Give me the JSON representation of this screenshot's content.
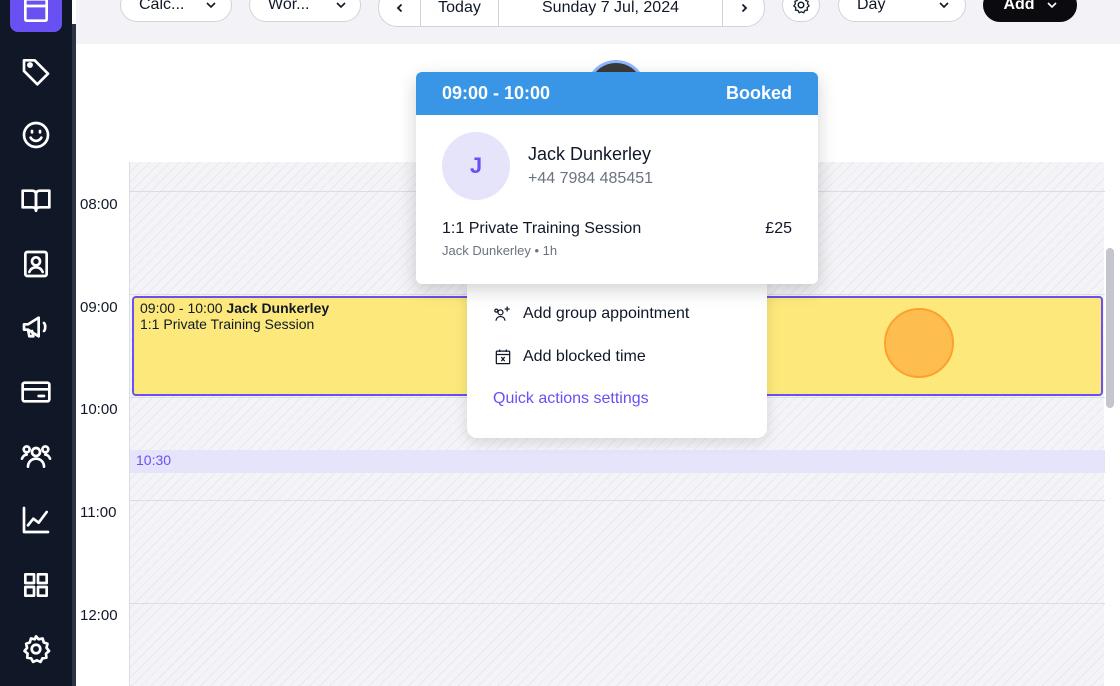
{
  "sidebar": {
    "items": [
      {
        "icon": "calendar-icon"
      },
      {
        "icon": "tag-icon"
      },
      {
        "icon": "smiley-icon"
      },
      {
        "icon": "book-icon"
      },
      {
        "icon": "contact-card-icon"
      },
      {
        "icon": "megaphone-icon"
      },
      {
        "icon": "credit-card-icon"
      },
      {
        "icon": "team-icon"
      },
      {
        "icon": "chart-icon"
      },
      {
        "icon": "apps-grid-icon"
      },
      {
        "icon": "gear-icon"
      }
    ]
  },
  "toolbar": {
    "calendar_select": "Calc...",
    "workspace_select": "Wor...",
    "today_label": "Today",
    "date_label": "Sunday 7 Jul, 2024",
    "view_select": "Day",
    "add_label": "Add"
  },
  "calendar": {
    "time_labels": [
      "08:00",
      "09:00",
      "10:00",
      "11:00",
      "12:00"
    ],
    "now_label": "10:30",
    "appointment": {
      "time": "09:00 - 10:00",
      "client": "Jack Dunkerley",
      "service": "1:1 Private Training Session",
      "color": "#fde97b"
    }
  },
  "popover": {
    "time": "09:00 - 10:00",
    "status": "Booked",
    "avatar_initial": "J",
    "client_name": "Jack Dunkerley",
    "phone": "+44 7984 485451",
    "service": "1:1 Private Training Session",
    "price": "£25",
    "sub": "Jack Dunkerley • 1h",
    "header_color": "#3996e6"
  },
  "quick_actions": {
    "items": [
      {
        "label": "Add group appointment",
        "icon": "group-add-icon"
      },
      {
        "label": "Add blocked time",
        "icon": "calendar-block-icon"
      }
    ],
    "settings_link": "Quick actions settings"
  },
  "colors": {
    "accent": "#6950f3",
    "sidebar_bg": "#101828"
  }
}
